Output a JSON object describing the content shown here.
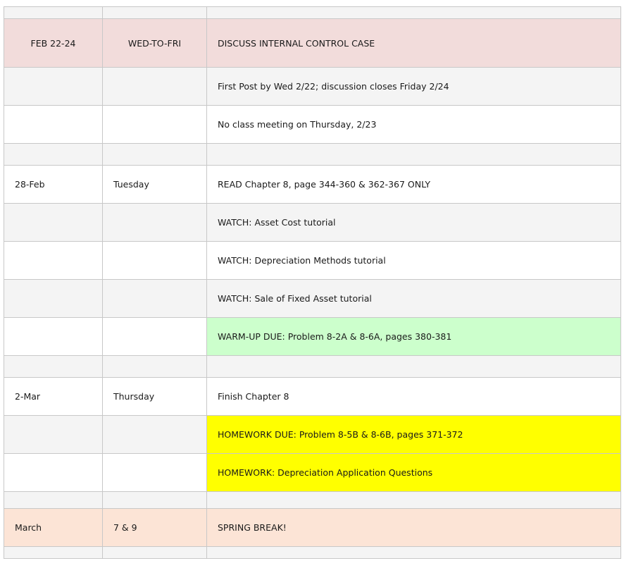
{
  "rows": {
    "feb22": {
      "date": "FEB 22-24",
      "day": "WED-TO-FRI",
      "task": "DISCUSS INTERNAL CONTROL CASE"
    },
    "feb22_r1": {
      "task": "First Post by Wed 2/22; discussion closes Friday 2/24"
    },
    "feb22_r2": {
      "task": "No class meeting on Thursday, 2/23"
    },
    "feb28": {
      "date": "28-Feb",
      "day": "Tuesday",
      "task": "READ Chapter 8, page 344-360 & 362-367 ONLY"
    },
    "feb28_r1": {
      "task": "WATCH: Asset Cost tutorial"
    },
    "feb28_r2": {
      "task": "WATCH: Depreciation Methods tutorial"
    },
    "feb28_r3": {
      "task": "WATCH: Sale of Fixed Asset tutorial"
    },
    "feb28_r4": {
      "task": "WARM-UP DUE: Problem 8-2A & 8-6A, pages 380-381"
    },
    "mar2": {
      "date": "2-Mar",
      "day": "Thursday",
      "task": "Finish Chapter 8"
    },
    "mar2_r1": {
      "task": "HOMEWORK DUE: Problem 8-5B & 8-6B, pages 371-372"
    },
    "mar2_r2": {
      "task": "HOMEWORK: Depreciation Application Questions"
    },
    "march": {
      "date": "March",
      "day": "7 & 9",
      "task": "SPRING BREAK!"
    }
  },
  "colors": {
    "header_pink": "#f2dcdb",
    "spring_break_peach": "#fce4d6",
    "warmup_green": "#ccffcc",
    "homework_yellow": "#ffff00",
    "alt_gray": "#f4f4f4",
    "border": "#c8c8c8"
  }
}
